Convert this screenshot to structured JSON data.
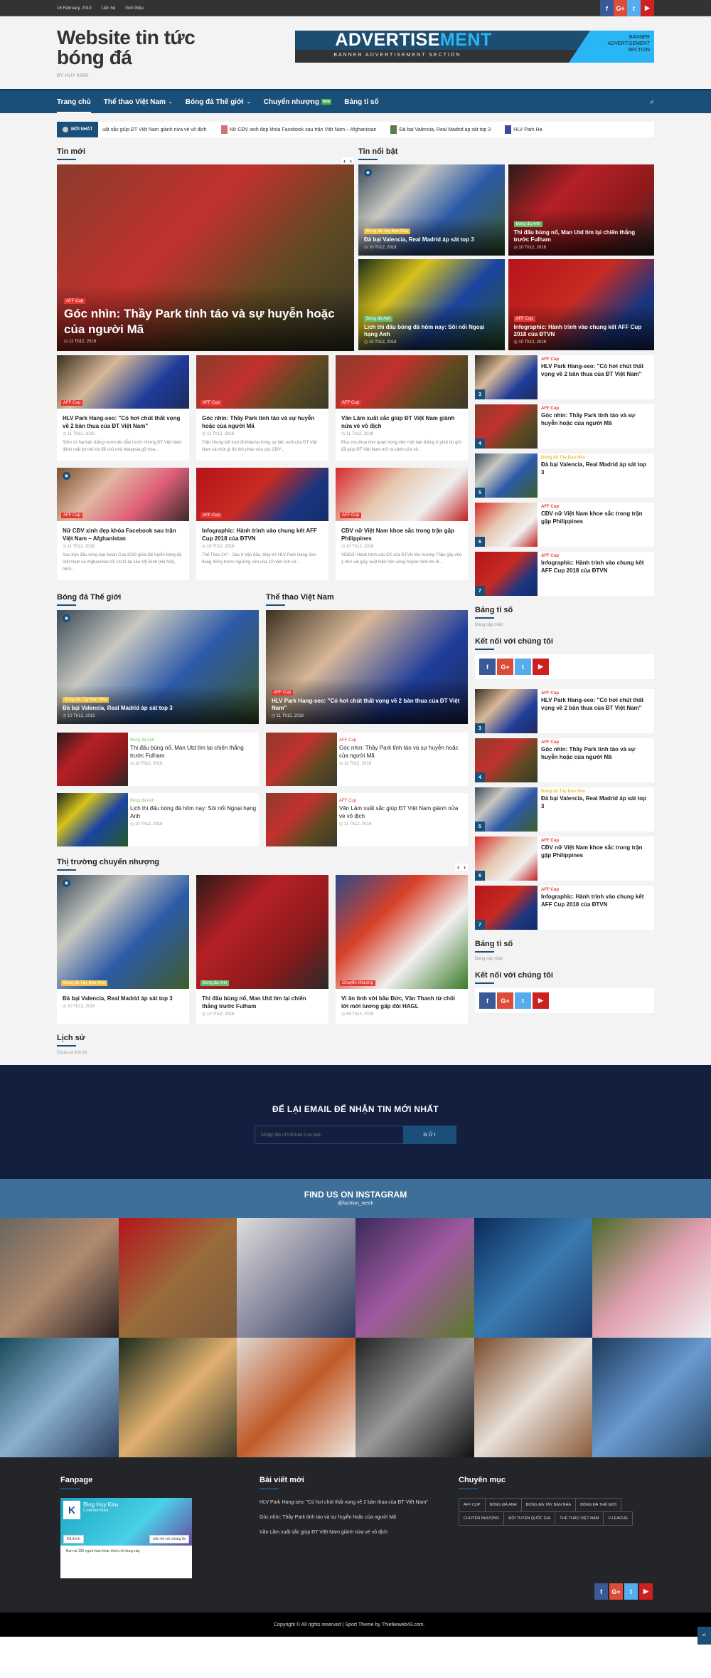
{
  "topbar": {
    "date": "16 February, 2019",
    "links": [
      "Liên hệ",
      "Giới thiệu"
    ]
  },
  "social": {
    "facebook": "f",
    "google": "G+",
    "twitter": "t",
    "youtube": "▶"
  },
  "header": {
    "title": "Website tin tức bóng đá",
    "by": "BY HUY KIRA"
  },
  "ad": {
    "big_a": "ADVERTISE",
    "big_b": "MENT",
    "small": "BANNER ADVERTISEMENT SECTION",
    "right": "BANNER ADVERTISEMENT SECTION"
  },
  "nav": {
    "items": [
      "Trang chủ",
      "Thể thao Việt Nam",
      "Bóng đá Thế giới",
      "Chuyển nhượng",
      "Bảng tỉ số"
    ],
    "new_badge": "New",
    "caret": "⌄",
    "search": "⌕"
  },
  "ticker": {
    "label": "MỚI NHẤT",
    "items": [
      "uất sắc giúp ĐT Việt Nam giành nửa vé vô địch",
      "Nữ CĐV xinh đẹp khóa Facebook sau trận Việt Nam – Afghanistan",
      "Đả bại Valencia, Real Madrid áp sát top 3",
      "HLV Park Ha"
    ]
  },
  "arrows": {
    "prev": "‹",
    "next": "›"
  },
  "tin_moi": {
    "title": "Tin mới",
    "featured": {
      "tag": "AFF Cup",
      "title": "Góc nhìn: Thầy Park tỉnh táo và sự huyễn hoặc của người Mã",
      "date": "◷ 11 Th12, 2018"
    },
    "cards": [
      {
        "tag": "AFF Cup",
        "title": "HLV Park Hang-seo: \"Có hơi chút thất vọng về 2 bàn thua của ĐT Việt Nam\"",
        "date": "◷ 11 Th12, 2018",
        "excerpt": "Sớm có hai bàn thắng vươn lên dẫn trước nhưng ĐT Việt Nam đánh mất lợi thế khi để chủ nhà Malaysia gỡ hòa..."
      },
      {
        "tag": "AFF Cup",
        "title": "Góc nhìn: Thầy Park tỉnh táo và sự huyễn hoặc của người Mã",
        "date": "◷ 11 Th12, 2018",
        "excerpt": "Trận chung kết lượt đi khép lại trong sự tiếc nuối của ĐT Việt Nam và chút gì đó thở phào của các CĐV..."
      },
      {
        "tag": "AFF Cup",
        "title": "Văn Lâm xuất sắc giúp ĐT Việt Nam giành nửa vé vô địch",
        "date": "◷ 11 Th12, 2018",
        "excerpt": "Pha cứu thua như quan trọng như một bàn thắng ở phút bù giờ đã giúp ĐT Việt Nam mở ra cánh cửa vô..."
      },
      {
        "tag": "AFF Cup",
        "title": "Nữ CĐV xinh đẹp khóa Facebook sau trận Việt Nam – Afghanistan",
        "date": "◷ 11 Th12, 2018",
        "excerpt": "Sau trận đấu vòng loại Asian Cup 2019 giữa đội tuyển bóng đá Việt Nam và Afghanistan tối 14/11 tại sân Mỹ Đình (Hà Nội), hình..."
      },
      {
        "tag": "AFF Cup",
        "title": "Infographic: Hành trình vào chung kết AFF Cup 2018 của ĐTVN",
        "date": "◷ 10 Th12, 2018",
        "excerpt": "Thể Thao 247 - Sau 6 trận đấu, thầy trò HLV Park Hang Seo đang đứng trước ngưỡng cửa của 10 năm lịch sử..."
      },
      {
        "tag": "AFF Cup",
        "title": "CĐV nữ Việt Nam khoe sắc trong trận gặp Philippines",
        "date": "◷ 10 Th12, 2018",
        "excerpt": "VIDEO: Hành trình vào CK của ĐTVN Ma Hương Thảo gây chú ý nhờ vải giấy xuất hiện trên sóng truyền hình khi đi..."
      }
    ]
  },
  "tin_noi_bat": {
    "title": "Tin nổi bật",
    "items": [
      {
        "tag": "Bóng đá Tây Ban Nha",
        "title": "Đả bại Valencia, Real Madrid áp sát top 3",
        "date": "◷ 10 Th12, 2018"
      },
      {
        "tag": "Bóng đá Anh",
        "title": "Thi đấu bùng nổ, Man Utd tìm lại chiến thắng trước Fulham",
        "date": "◷ 10 Th12, 2018"
      },
      {
        "tag": "Bóng đá Anh",
        "title": "Lịch thi đấu bóng đá hôm nay: Sôi nổi Ngoại hạng Anh",
        "date": "◷ 10 Th12, 2018"
      },
      {
        "tag": "AFF Cup",
        "title": "Infographic: Hành trình vào chung kết AFF Cup 2018 của ĐTVN",
        "date": "◷ 10 Th12, 2018"
      }
    ]
  },
  "sidebar_list": [
    {
      "num": "3",
      "cat": "AFF Cup",
      "title": "HLV Park Hang-seo: \"Có hơi chút thất vọng về 2 bàn thua của ĐT Việt Nam\""
    },
    {
      "num": "4",
      "cat": "AFF Cup",
      "title": "Góc nhìn: Thầy Park tỉnh táo và sự huyễn hoặc của người Mã"
    },
    {
      "num": "5",
      "cat": "Bóng đá Tây Ban Nha",
      "title": "Đả bại Valencia, Real Madrid áp sát top 3"
    },
    {
      "num": "6",
      "cat": "AFF Cup",
      "title": "CĐV nữ Việt Nam khoe sắc trong trận gặp Philippines"
    },
    {
      "num": "7",
      "cat": "AFF Cup",
      "title": "Infographic: Hành trình vào chung kết AFF Cup 2018 của ĐTVN"
    }
  ],
  "widgets": {
    "bang_ti_so": "Bảng tỉ số",
    "updating": "Đang cập nhật",
    "ket_noi": "Kết nối với chúng tôi"
  },
  "bong_da_the_gioi": {
    "title": "Bóng đá Thế giới",
    "featured": {
      "tag": "Bóng đá Tây Ban Nha",
      "title": "Đả bại Valencia, Real Madrid áp sát top 3",
      "date": "◷ 10 Th12, 2018"
    },
    "items": [
      {
        "cat": "Bóng đá Anh",
        "title": "Thi đấu bùng nổ, Man Utd tìm lại chiến thắng trước Fulham",
        "date": "◷ 10 Th12, 2018"
      },
      {
        "cat": "Bóng đá Anh",
        "title": "Lịch thi đấu bóng đá hôm nay: Sôi nổi Ngoại hạng Anh",
        "date": "◷ 10 Th12, 2018"
      }
    ]
  },
  "the_thao_vn": {
    "title": "Thể thao Việt Nam",
    "featured": {
      "tag": "AFF Cup",
      "title": "HLV Park Hang-seo: \"Có hơi chút thất vọng về 2 bàn thua của ĐT Việt Nam\"",
      "date": "◷ 11 Th12, 2018"
    },
    "items": [
      {
        "cat": "AFF Cup",
        "title": "Góc nhìn: Thầy Park tỉnh táo và sự huyễn hoặc của người Mã",
        "date": "◷ 11 Th12, 2018"
      },
      {
        "cat": "AFF Cup",
        "title": "Văn Lâm xuất sắc giúp ĐT Việt Nam giành nửa vé vô địch",
        "date": "◷ 11 Th12, 2018"
      }
    ]
  },
  "chuyen_nhuong": {
    "title": "Thị trường chuyển nhượng",
    "cards": [
      {
        "tag": "Bóng đá Tây Ban Nha",
        "title": "Đả bại Valencia, Real Madrid áp sát top 3",
        "date": "◷ 10 Th12, 2018"
      },
      {
        "tag": "Bóng đá Anh",
        "title": "Thi đấu bùng nổ, Man Utd tìm lại chiến thắng trước Fulham",
        "date": "◷ 10 Th12, 2018"
      },
      {
        "tag": "Chuyển nhượng",
        "title": "Vì ân tình với bầu Đức, Văn Thanh từ chối lời mời lương gấp đôi HAGL",
        "date": "◷ 09 Th12, 2018"
      }
    ]
  },
  "lich_su": {
    "title": "Lịch sử",
    "empty": "Chưa có lịch sử"
  },
  "newsletter": {
    "title": "ĐỂ LẠI EMAIL ĐỂ NHẬN TIN MỚI NHẤT",
    "placeholder": "Nhập địa chỉ Email của bạn",
    "button": "GỬI"
  },
  "instagram": {
    "title": "FIND US ON INSTAGRAM",
    "handle": "@fashion_week"
  },
  "footer": {
    "fanpage": {
      "title": "Fanpage",
      "name": "Blog Huy Kira",
      "likes": "5.344 lượt thích",
      "liked": "Đã thích",
      "contact": "Liên hệ với chúng tôi",
      "friends": "Bạn và 195 người bạn khác thích nội dung này"
    },
    "posts": {
      "title": "Bài viết mới",
      "items": [
        "HLV Park Hang-seo: \"Có hơi chút thất vọng về 2 bàn thua của ĐT Việt Nam\"",
        "Góc nhìn: Thầy Park tỉnh táo và sự huyễn hoặc của người Mã",
        "Văn Lâm xuất sắc giúp ĐT Việt Nam giành nửa vé vô địch"
      ]
    },
    "cats": {
      "title": "Chuyên mục",
      "items": [
        "AFF CUP",
        "BÓNG ĐÁ ANH",
        "BÓNG ĐÁ TÂY BAN NHA",
        "BÓNG ĐÁ THẾ GIỚI",
        "CHUYỂN NHƯỢNG",
        "ĐỘI TUYỂN QUỐC GIA",
        "THỂ THAO VIỆT NAM",
        "V-LEAGUE"
      ]
    },
    "copyright": "Copyright © All rights reserved | Sport Theme by Thietkeweb43.com.",
    "totop": "^"
  }
}
